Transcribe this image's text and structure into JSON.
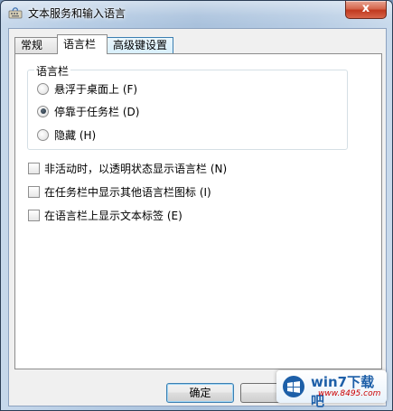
{
  "window": {
    "title": "文本服务和输入语言",
    "close_glyph": "x"
  },
  "tabs": [
    {
      "label": "常规"
    },
    {
      "label": "语言栏"
    },
    {
      "label": "高级键设置"
    }
  ],
  "language_bar": {
    "group_title": "语言栏",
    "options": [
      {
        "label": "悬浮于桌面上 (F)",
        "checked": false
      },
      {
        "label": "停靠于任务栏 (D)",
        "checked": true
      },
      {
        "label": "隐藏 (H)",
        "checked": false
      }
    ]
  },
  "checkboxes": [
    {
      "label": "非活动时，以透明状态显示语言栏 (N)",
      "checked": false
    },
    {
      "label": "在任务栏中显示其他语言栏图标 (I)",
      "checked": false
    },
    {
      "label": "在语言栏上显示文本标签 (E)",
      "checked": false
    }
  ],
  "buttons": {
    "ok": "确定"
  },
  "watermark": {
    "text": "win7下载吧",
    "url": "www.8495.com"
  },
  "colors": {
    "accent": "#3c7fb1",
    "close": "#c0391f"
  }
}
